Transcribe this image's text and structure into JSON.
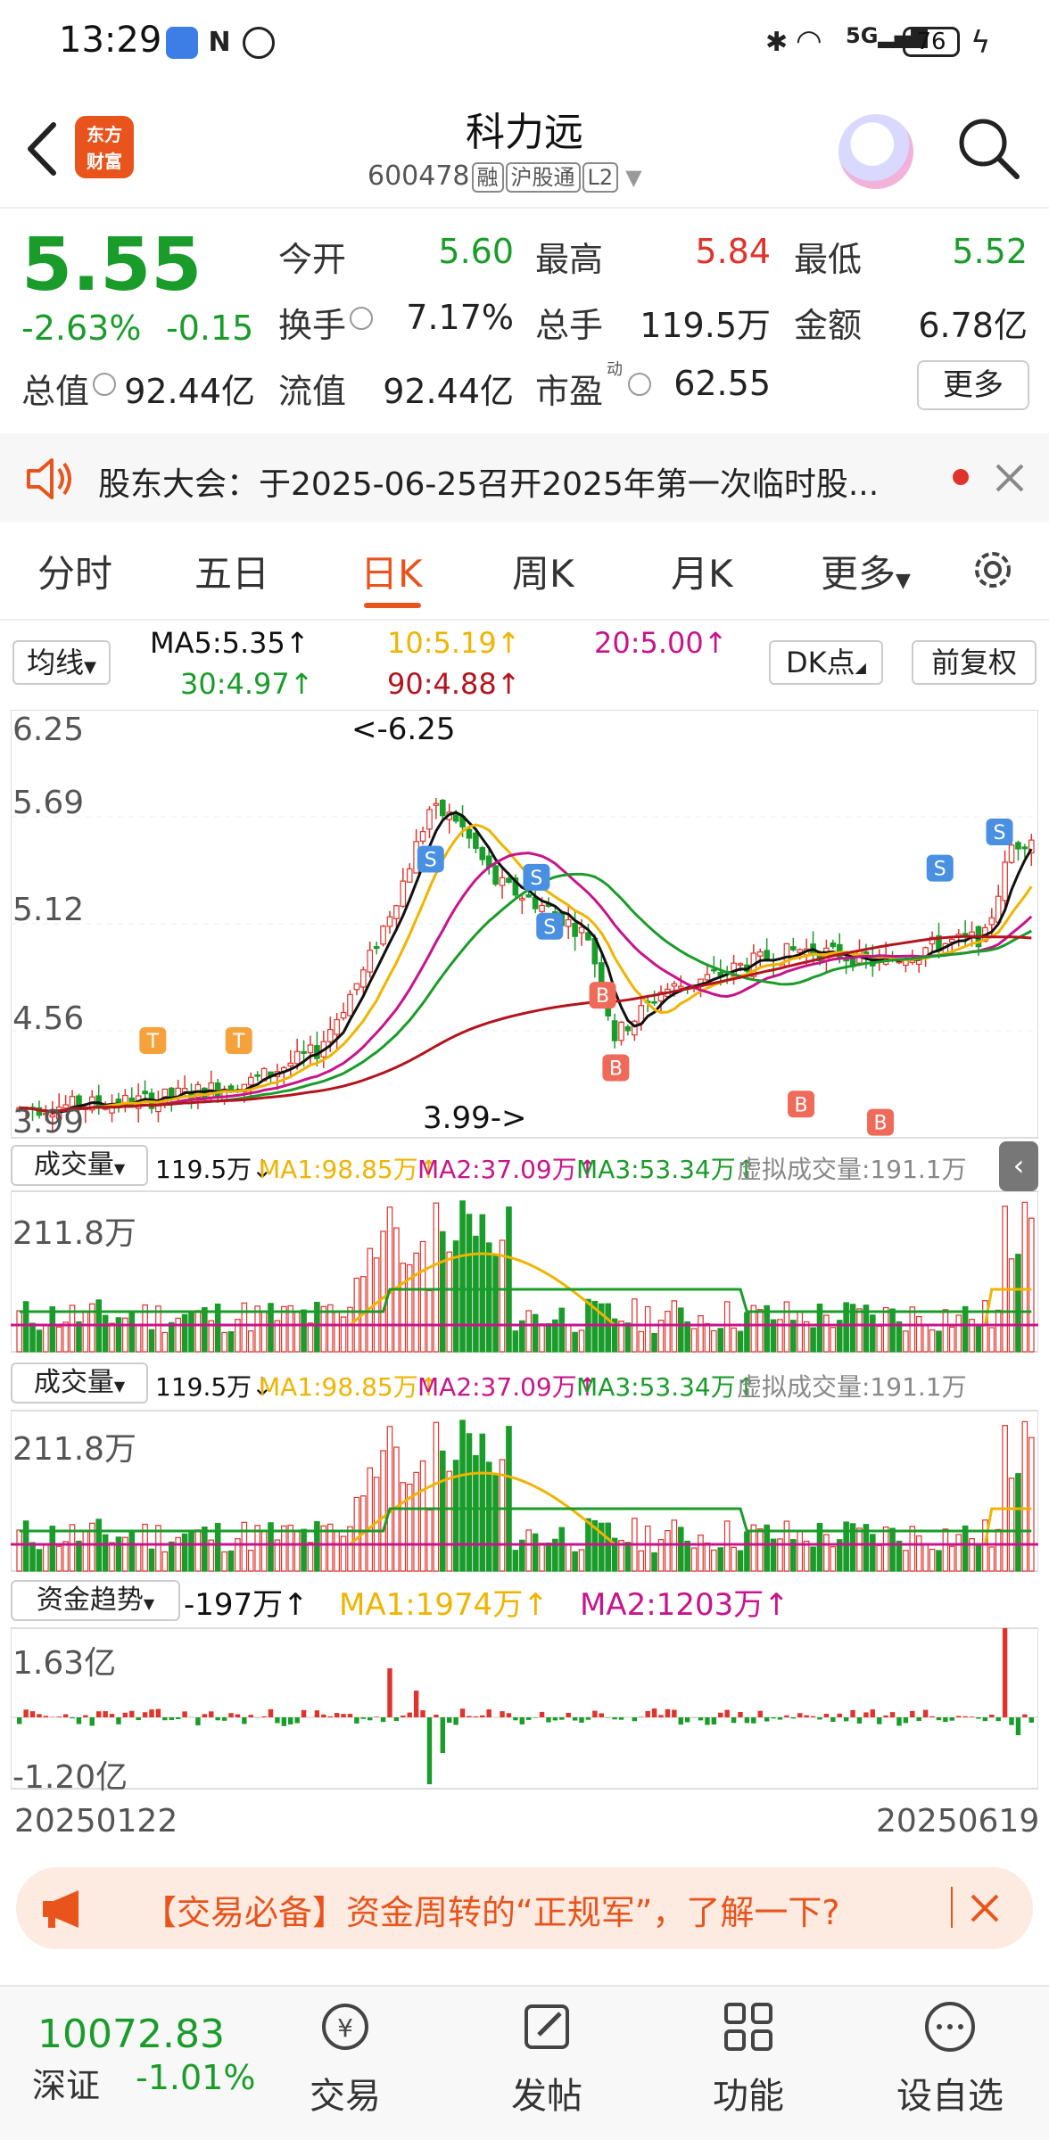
{
  "status_bar": {
    "time": "13:29",
    "battery": "76",
    "network": "5G"
  },
  "header": {
    "app_logo_line1": "东方",
    "app_logo_line2": "财富",
    "stock_name": "科力远",
    "stock_code": "600478",
    "tags": [
      "融",
      "沪股通",
      "L2"
    ]
  },
  "quote": {
    "price": "5.55",
    "change_pct": "-2.63%",
    "change_val": "-0.15",
    "stats": [
      {
        "label": "今开",
        "value": "5.60",
        "color": "green"
      },
      {
        "label": "最高",
        "value": "5.84",
        "color": "red"
      },
      {
        "label": "最低",
        "value": "5.52",
        "color": "green"
      },
      {
        "label": "换手",
        "value": "7.17%",
        "color": "black"
      },
      {
        "label": "总手",
        "value": "119.5万",
        "color": "black"
      },
      {
        "label": "金额",
        "value": "6.78亿",
        "color": "black"
      },
      {
        "label": "总值",
        "value": "92.44亿",
        "color": "black"
      },
      {
        "label": "流值",
        "value": "92.44亿",
        "color": "black"
      },
      {
        "label": "市盈",
        "sup": "动",
        "value": "62.55",
        "color": "black"
      }
    ],
    "more_label": "更多"
  },
  "notice": {
    "text": "股东大会：于2025-06-25召开2025年第一次临时股..."
  },
  "tabs": [
    "分时",
    "五日",
    "日K",
    "周K",
    "月K",
    "更多"
  ],
  "active_tab": "日K",
  "ma_legend": {
    "selector": "均线",
    "ma5": "MA5:5.35↑",
    "ma10": "10:5.19↑",
    "ma20": "20:5.00↑",
    "ma30": "30:4.97↑",
    "ma90": "90:4.88↑",
    "dk_selector": "DK点",
    "adjust_selector": "前复权"
  },
  "chart": {
    "y_labels": [
      "6.25",
      "5.69",
      "5.12",
      "4.56",
      "3.99"
    ],
    "high_marker": "<-6.25",
    "low_marker": "3.99->",
    "volume_panel": {
      "selector": "成交量",
      "vol": "119.5万↓",
      "ma1": "MA1:98.85万↑",
      "ma2": "MA2:37.09万↑",
      "ma3": "MA3:53.34万↑",
      "virtual": "虚拟成交量:191.1万",
      "max_label": "211.8万"
    },
    "fund_panel": {
      "selector": "资金趋势",
      "value": "-197万↑",
      "ma1": "MA1:1974万↑",
      "ma2": "MA2:1203万↑",
      "max_label": "1.63亿",
      "min_label": "-1.20亿"
    },
    "start_date": "20250122",
    "end_date": "20250619",
    "colors": {
      "up": "#e0332b",
      "down": "#1a9c2a",
      "ma5": "#111111",
      "ma10": "#f0b400",
      "ma20": "#c8148c",
      "ma30": "#1a9c2a",
      "ma90": "#b4141e"
    }
  },
  "chart_data": {
    "type": "line",
    "title": "",
    "ylim": [
      3.99,
      6.25
    ],
    "x_start": "20250122",
    "x_end": "20250619",
    "series": [
      {
        "name": "MA5",
        "last": 5.35
      },
      {
        "name": "10",
        "last": 5.19
      },
      {
        "name": "20",
        "last": 5.0
      },
      {
        "name": "30",
        "last": 4.97
      },
      {
        "name": "90",
        "last": 4.88
      }
    ]
  },
  "promo": {
    "text": "【交易必备】资金周转的“正规军”，了解一下?"
  },
  "bottom_nav": {
    "index_value": "10072.83",
    "index_name": "深证",
    "index_change": "-1.01%",
    "items": [
      "交易",
      "发帖",
      "功能",
      "设自选"
    ]
  }
}
